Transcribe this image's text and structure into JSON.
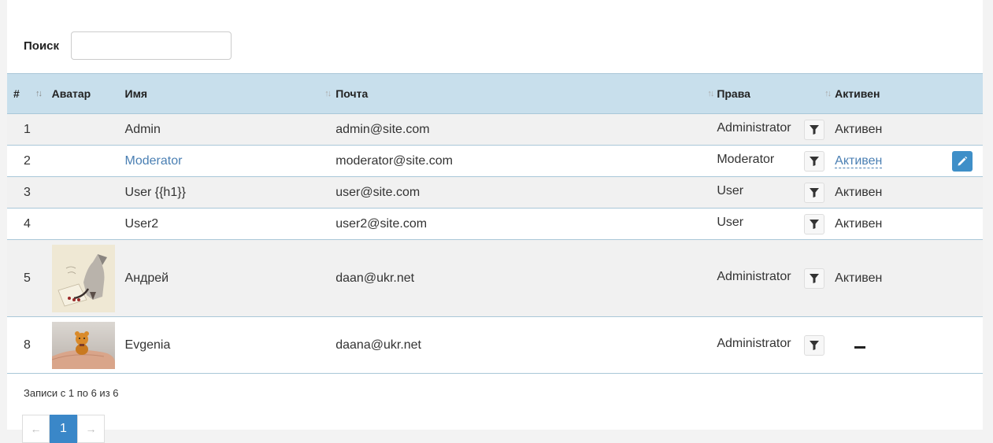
{
  "search": {
    "label": "Поиск",
    "value": "",
    "placeholder": ""
  },
  "columns": {
    "num": "#",
    "avatar": "Аватар",
    "name": "Имя",
    "email": "Почта",
    "role": "Права",
    "active": "Активен"
  },
  "rows": [
    {
      "num": "1",
      "name": "Admin",
      "name_is_link": false,
      "email": "admin@site.com",
      "role": "Administrator",
      "active": "Активен"
    },
    {
      "num": "2",
      "name": "Moderator",
      "name_is_link": true,
      "email": "moderator@site.com",
      "role": "Moderator",
      "active": "Активен"
    },
    {
      "num": "3",
      "name": "User {{h1}}",
      "name_is_link": false,
      "email": "user@site.com",
      "role": "User",
      "active": "Активен"
    },
    {
      "num": "4",
      "name": "User2",
      "name_is_link": false,
      "email": "user2@site.com",
      "role": "User",
      "active": "Активен"
    },
    {
      "num": "5",
      "name": "Андрей",
      "name_is_link": false,
      "email": "daan@ukr.net",
      "role": "Administrator",
      "active": "Активен"
    },
    {
      "num": "8",
      "name": "Evgenia",
      "name_is_link": false,
      "email": "daana@ukr.net",
      "role": "Administrator",
      "active": ""
    }
  ],
  "footer": {
    "info": "Записи с 1 по 6 из 6"
  },
  "pagination": {
    "prev": "←",
    "current": "1",
    "next": "→"
  },
  "colors": {
    "header_bg": "#c8dfec",
    "link": "#4a7fb3",
    "edit_button": "#3f8fc8",
    "page_active": "#3a87c8"
  },
  "icons": {
    "filter": "funnel-icon",
    "edit": "pencil-icon",
    "inactive": "minus-icon"
  }
}
